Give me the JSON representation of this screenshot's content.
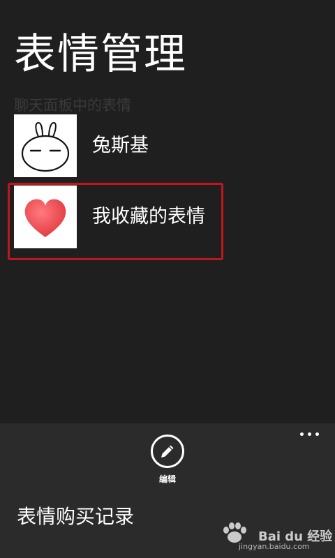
{
  "page": {
    "title": "表情管理",
    "section_label": "聊天面板中的表情"
  },
  "list": {
    "items": [
      {
        "label": "兔斯基",
        "icon": "tuzki-rabbit-icon"
      },
      {
        "label": "我收藏的表情",
        "icon": "heart-icon"
      }
    ],
    "highlight_color": "#c0161d"
  },
  "app_bar": {
    "edit_label": "编辑",
    "more_icon": "more-dots-icon",
    "menu_items": [
      {
        "label": "表情购买记录"
      }
    ]
  },
  "watermark": {
    "brand": "Bai du 经验",
    "url": "jingyan.baidu.com"
  },
  "colors": {
    "background": "#1f1f1f",
    "app_bar": "#2b2b2b",
    "heart": "#e84a4f",
    "section_label": "#3a3a3a"
  }
}
